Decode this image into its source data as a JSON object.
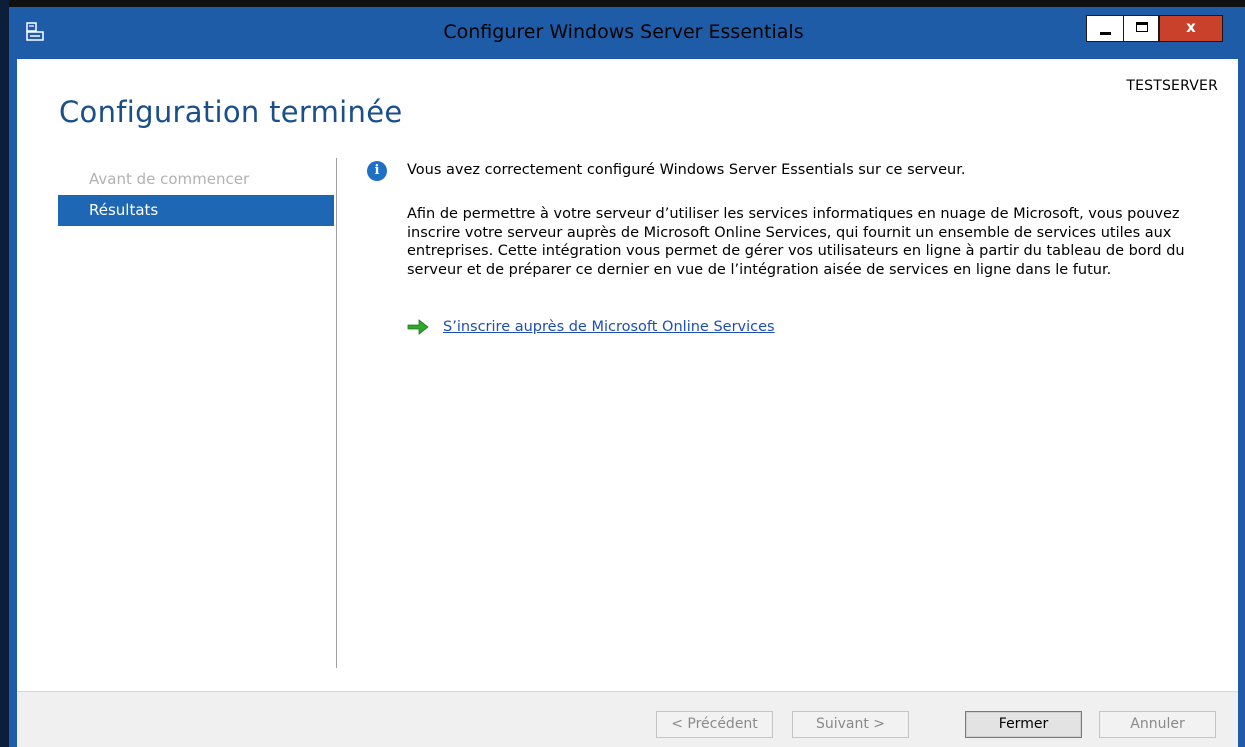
{
  "window": {
    "title": "Configurer Windows Server Essentials",
    "close_glyph": "x",
    "app_icon": "server-setup-icon",
    "accent_color": "#1e5ca8"
  },
  "header": {
    "server_name": "TESTSERVER",
    "page_title": "Configuration terminée"
  },
  "nav": {
    "items": [
      {
        "label": "Avant de commencer",
        "state": "inactive"
      },
      {
        "label": "Résultats",
        "state": "active"
      }
    ]
  },
  "main": {
    "info_icon": "info-icon",
    "info_text": "Vous avez correctement configuré Windows Server Essentials sur ce serveur.",
    "paragraph": "Afin de permettre à votre serveur d’utiliser les services informatiques en nuage de Microsoft, vous pouvez inscrire votre serveur auprès de Microsoft Online Services, qui fournit un ensemble de services utiles aux entreprises. Cette intégration vous permet de gérer vos utilisateurs en ligne à partir du tableau de bord du serveur et de préparer ce dernier en vue de l’intégration aisée de services en ligne dans le futur.",
    "link_icon": "green-arrow-icon",
    "link_text": "S’inscrire auprès de Microsoft Online Services"
  },
  "footer": {
    "prev_label": "< Précédent",
    "next_label": "Suivant >",
    "close_label": "Fermer",
    "cancel_label": "Annuler"
  }
}
